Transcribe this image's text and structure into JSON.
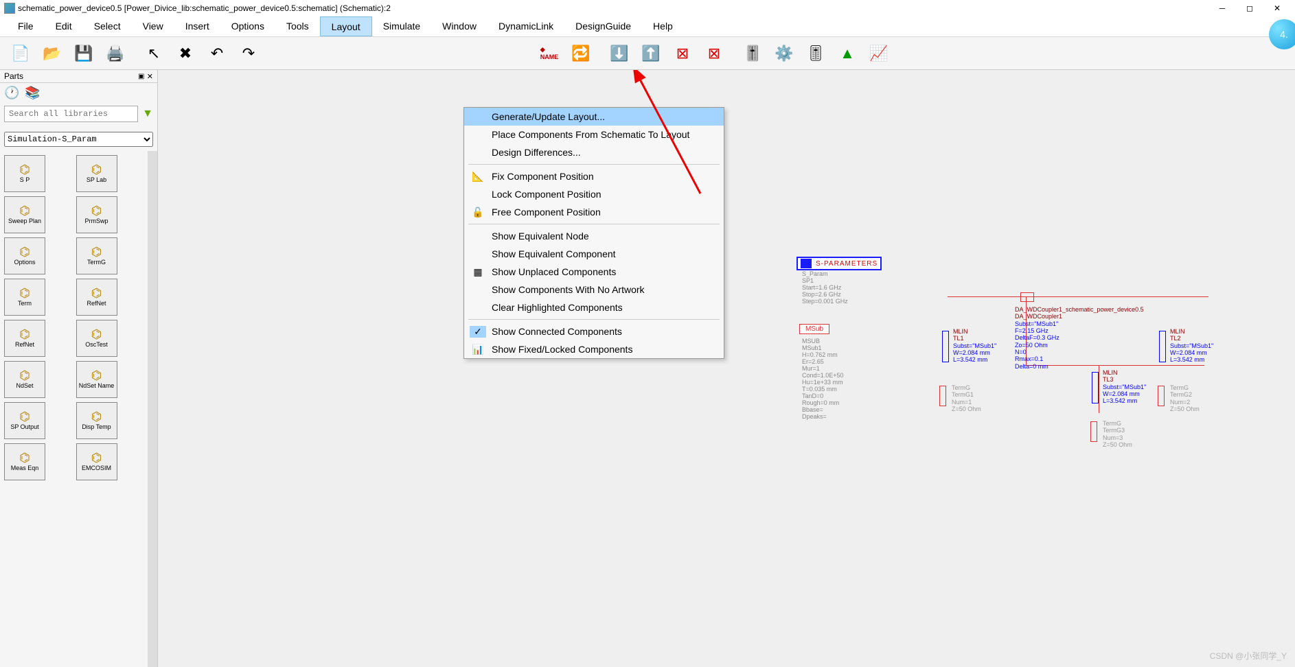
{
  "title": "schematic_power_device0.5 [Power_Divice_lib:schematic_power_device0.5:schematic] (Schematic):2",
  "circleBadge": "4.",
  "menus": [
    "File",
    "Edit",
    "Select",
    "View",
    "Insert",
    "Options",
    "Tools",
    "Layout",
    "Simulate",
    "Window",
    "DynamicLink",
    "DesignGuide",
    "Help"
  ],
  "activeMenu": "Layout",
  "dropdown": {
    "items": [
      {
        "label": "Generate/Update Layout...",
        "hl": true
      },
      {
        "label": "Place Components From Schematic To Layout"
      },
      {
        "label": "Design Differences..."
      },
      {
        "sep": true
      },
      {
        "label": "Fix Component Position",
        "icon": "📐"
      },
      {
        "label": "Lock Component Position"
      },
      {
        "label": "Free Component Position",
        "icon": "🔓"
      },
      {
        "sep": true
      },
      {
        "label": "Show Equivalent Node"
      },
      {
        "label": "Show Equivalent Component"
      },
      {
        "label": "Show Unplaced Components",
        "icon": "▦"
      },
      {
        "label": "Show Components With No Artwork"
      },
      {
        "label": "Clear Highlighted Components"
      },
      {
        "sep": true
      },
      {
        "label": "Show Connected Components",
        "icon": "✓",
        "checked": true
      },
      {
        "label": "Show Fixed/Locked Components",
        "icon": "📊"
      }
    ]
  },
  "partsPanel": {
    "title": "Parts",
    "searchPlaceholder": "Search all libraries",
    "library": "Simulation-S_Param",
    "items": [
      {
        "label": "S P"
      },
      {
        "label": "SP Lab"
      },
      {
        "label": "Sweep Plan"
      },
      {
        "label": "PrmSwp"
      },
      {
        "label": "Options"
      },
      {
        "label": "TermG"
      },
      {
        "label": "Term"
      },
      {
        "label": "RefNet"
      },
      {
        "label": "RefNet"
      },
      {
        "label": "OscTest"
      },
      {
        "label": "NdSet"
      },
      {
        "label": "NdSet Name"
      },
      {
        "label": "SP Output"
      },
      {
        "label": "Disp Temp"
      },
      {
        "label": "Meas Eqn"
      },
      {
        "label": "EMCOSIM"
      }
    ]
  },
  "schematic": {
    "sparamTitle": "S-PARAMETERS",
    "sparamText": [
      "S_Param",
      "SP1",
      "Start=1.6 GHz",
      "Stop=2.6 GHz",
      "Step=0.001 GHz"
    ],
    "msubTitle": "MSub",
    "msubText": [
      "MSUB",
      "MSub1",
      "H=0.762 mm",
      "Er=2.65",
      "Mur=1",
      "Cond=1.0E+50",
      "Hu=1e+33 mm",
      "T=0.035 mm",
      "TanD=0",
      "Rough=0 mm",
      "Bbase=",
      "Dpeaks="
    ],
    "coupler": [
      "DA_WDCoupler1_schematic_power_device0.5",
      "DA_WDCoupler1",
      "Subst=\"MSub1\"",
      "F=2.15 GHz",
      "DeltaF=0.3 GHz",
      "Zo=50 Ohm",
      "N=0",
      "Rmax=0.1",
      "Delta=0 mm"
    ],
    "tl1": [
      "MLIN",
      "TL1",
      "Subst=\"MSub1\"",
      "W=2.084 mm",
      "L=3.542 mm"
    ],
    "tl2": [
      "MLIN",
      "TL2",
      "Subst=\"MSub1\"",
      "W=2.084 mm",
      "L=3.542 mm"
    ],
    "tl3": [
      "MLIN",
      "TL3",
      "Subst=\"MSub1\"",
      "W=2.084 mm",
      "L=3.542 mm"
    ],
    "term1": [
      "TermG",
      "TermG1",
      "Num=1",
      "Z=50 Ohm"
    ],
    "term2": [
      "TermG",
      "TermG2",
      "Num=2",
      "Z=50 Ohm"
    ],
    "term3": [
      "TermG",
      "TermG3",
      "Num=3",
      "Z=50 Ohm"
    ]
  },
  "watermark": "CSDN @小张同学_Y"
}
